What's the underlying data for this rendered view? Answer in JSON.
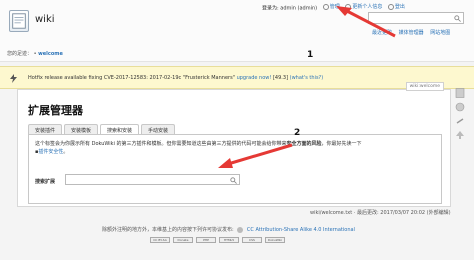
{
  "header": {
    "site_title": "wiki",
    "user_text": "登录为: admin (admin)",
    "user_links": [
      "管理",
      "更新个人信息",
      "登出"
    ],
    "site_tools": [
      "最近更改",
      "媒体管理器",
      "网站地图"
    ],
    "breadcrumb_label": "您的足迹：",
    "breadcrumb_item": "welcome"
  },
  "notice": {
    "text": "Hotfix release available fixing CVE-2017-12583: 2017-02-19c \"Frusterick Manners\"",
    "link1": "upgrade now!",
    "version": "[49.3]",
    "link2": "(what's this?)"
  },
  "page": {
    "id": "wiki:welcome",
    "title": "扩展管理器",
    "tabs": [
      "安装插件",
      "安装模板",
      "搜索和安装",
      "手动安装"
    ],
    "intro_line1_a": "这个标签会为你展示所有 DokuWiki 的第三方插件和模板。但你需要知道这些由第三方提供的代码可能会给你带来",
    "intro_line1_bold": "安全方面的风险",
    "intro_line1_b": "，你最好先读一下",
    "intro_link": "插件安全性",
    "intro_end": "。",
    "search_label": "搜索扩展"
  },
  "doc_info": "wiki/welcome.txt · 最后更改: 2017/03/07 20:02 (外部编辑)",
  "footer": {
    "license_text": "除额外注明的地方外，本维基上的内容按下列许可协议发布:",
    "license_link": "CC Attribution-Share Alike 4.0 International",
    "badges": [
      "CC BY-SA",
      "Donate",
      "PHP",
      "HTML5",
      "CSS",
      "DokuWiki"
    ]
  },
  "annotations": {
    "num1": "1",
    "num2": "2"
  },
  "colors": {
    "accent": "#2b73b7",
    "arrow": "#e53935",
    "notice_bg": "#fdf8cf"
  }
}
